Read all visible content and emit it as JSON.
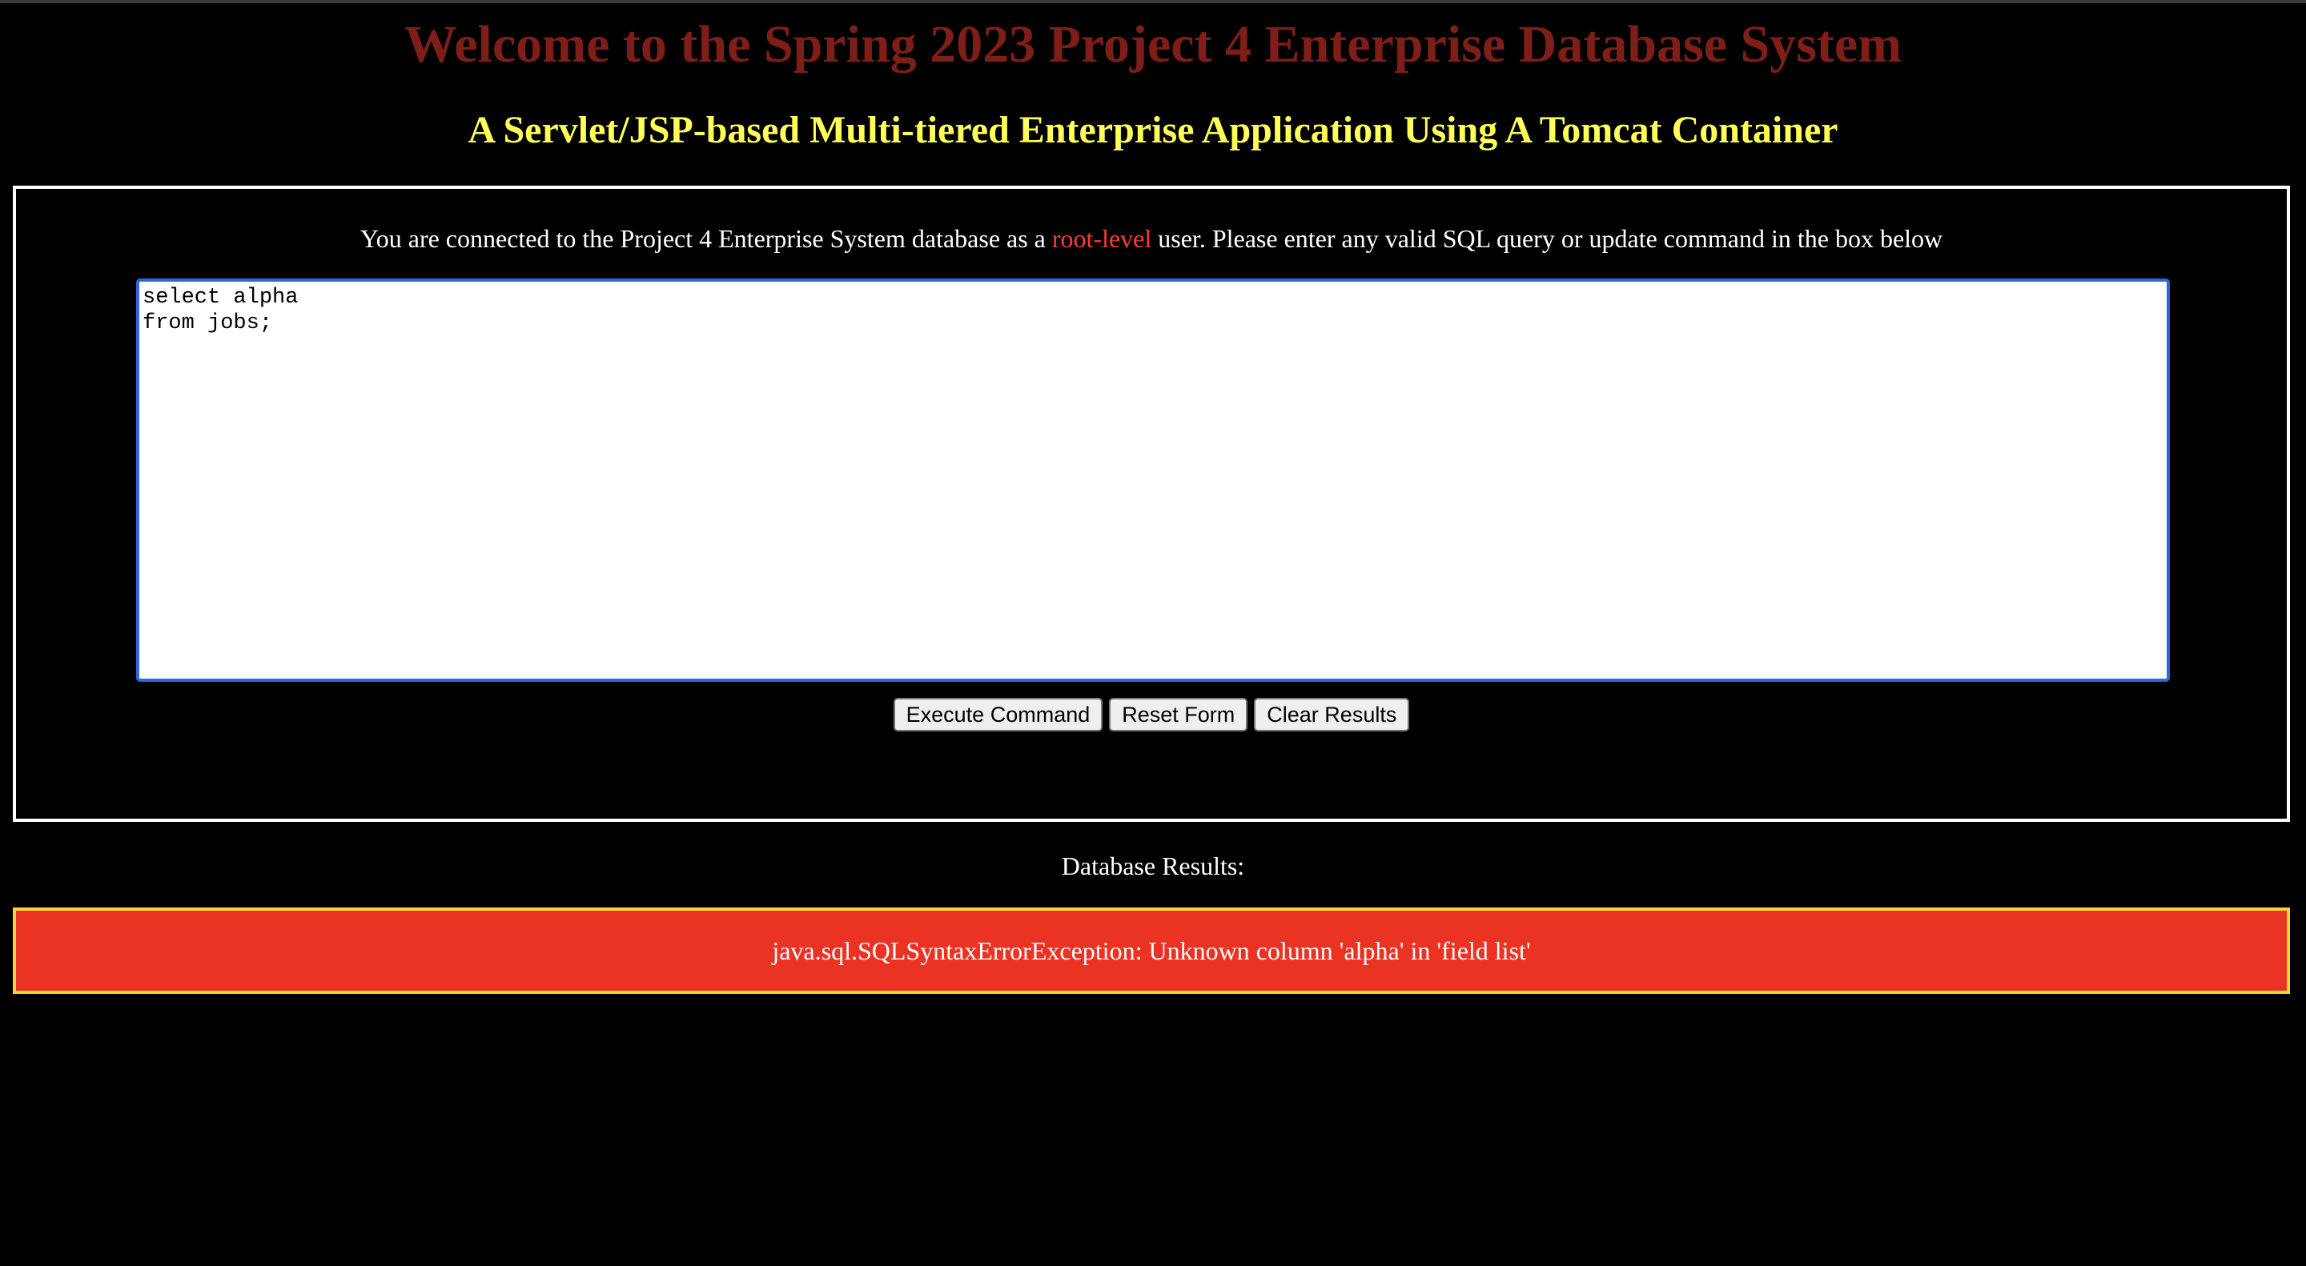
{
  "header": {
    "title": "Welcome to the Spring 2023 Project 4 Enterprise Database System",
    "subtitle": "A Servlet/JSP-based Multi-tiered Enterprise Application Using A Tomcat Container"
  },
  "query_panel": {
    "info_prefix": "You are connected to the Project 4 Enterprise System database as a ",
    "user_level": "root-level",
    "info_suffix": " user. Please enter any valid SQL query or update command in the box below",
    "sql_text": "select alpha\nfrom jobs;",
    "buttons": {
      "execute": "Execute Command",
      "reset": "Reset Form",
      "clear": "Clear Results"
    }
  },
  "results": {
    "label": "Database Results:",
    "message": "java.sql.SQLSyntaxErrorException: Unknown column 'alpha' in 'field list'"
  },
  "colors": {
    "title": "#7f1d18",
    "subtitle": "#ffff57",
    "user_level": "#ff3b30",
    "error_background": "#ea3323",
    "error_border": "#f3d53a",
    "input_focus_border": "#2f67d9"
  }
}
